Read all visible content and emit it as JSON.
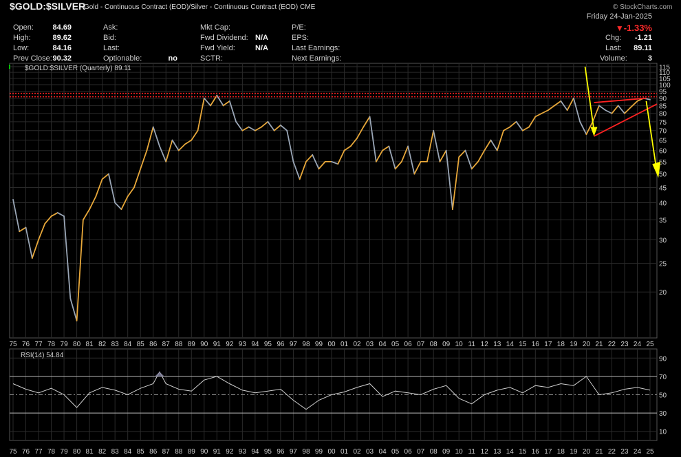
{
  "header": {
    "symbol": "$GOLD:$SILVER",
    "description": "Gold - Continuous Contract (EOD)/Silver - Continuous Contract (EOD)",
    "exchange": "CME",
    "watermark": "© StockCharts.com",
    "date": "Friday 24-Jan-2025",
    "change_pct": "-1.33%"
  },
  "quote": {
    "open_label": "Open:",
    "open": "84.69",
    "high_label": "High:",
    "high": "89.62",
    "low_label": "Low:",
    "low": "84.16",
    "prev_label": "Prev Close:",
    "prev": "90.32",
    "ask_label": "Ask:",
    "bid_label": "Bid:",
    "last_label": "Last:",
    "optionable_label": "Optionable:",
    "optionable": "no",
    "mktcap_label": "Mkt Cap:",
    "fwddiv_label": "Fwd Dividend:",
    "fwddiv": "N/A",
    "fwdyield_label": "Fwd Yield:",
    "fwdyield": "N/A",
    "sctr_label": "SCTR:",
    "pe_label": "P/E:",
    "eps_label": "EPS:",
    "lastearn_label": "Last Earnings:",
    "nextearn_label": "Next Earnings:",
    "chg_label": "Chg:",
    "chg": "-1.21",
    "last2_label": "Last:",
    "last2": "89.11",
    "volume_label": "Volume:",
    "volume": "3"
  },
  "colors": {
    "background": "#000000",
    "grid": "#2a2a2a",
    "up": "#e8a83a",
    "down": "#9aa6b6",
    "trend": "#ff2222",
    "arrow": "#ffff00",
    "rsi": "#d0d0d0"
  },
  "chart_data": [
    {
      "type": "line",
      "legend": "$GOLD:$SILVER (Quarterly) 89.11",
      "yscale": "log",
      "ylim": [
        14,
        118
      ],
      "y_ticks": [
        20,
        25,
        30,
        35,
        40,
        45,
        50,
        55,
        60,
        65,
        70,
        75,
        80,
        85,
        90,
        95,
        100,
        105,
        110,
        115
      ],
      "x_ticks": [
        "75",
        "76",
        "77",
        "78",
        "79",
        "80",
        "81",
        "82",
        "83",
        "84",
        "85",
        "86",
        "87",
        "88",
        "89",
        "90",
        "91",
        "92",
        "93",
        "94",
        "95",
        "96",
        "97",
        "98",
        "99",
        "00",
        "01",
        "02",
        "03",
        "04",
        "05",
        "06",
        "07",
        "08",
        "09",
        "10",
        "11",
        "12",
        "13",
        "14",
        "15",
        "16",
        "17",
        "18",
        "19",
        "20",
        "21",
        "22",
        "23",
        "24",
        "25"
      ],
      "x_years_start": 1975,
      "x_years_end": 2025,
      "x": [
        1975.0,
        1975.5,
        1976.0,
        1976.5,
        1977.0,
        1977.5,
        1978.0,
        1978.5,
        1979.0,
        1979.5,
        1980.0,
        1980.5,
        1981.0,
        1981.5,
        1982.0,
        1982.5,
        1983.0,
        1983.5,
        1984.0,
        1984.5,
        1985.0,
        1985.5,
        1986.0,
        1986.5,
        1987.0,
        1987.5,
        1988.0,
        1988.5,
        1989.0,
        1989.5,
        1990.0,
        1990.5,
        1991.0,
        1991.5,
        1992.0,
        1992.5,
        1993.0,
        1993.5,
        1994.0,
        1994.5,
        1995.0,
        1995.5,
        1996.0,
        1996.5,
        1997.0,
        1997.5,
        1998.0,
        1998.5,
        1999.0,
        1999.5,
        2000.0,
        2000.5,
        2001.0,
        2001.5,
        2002.0,
        2002.5,
        2003.0,
        2003.5,
        2004.0,
        2004.5,
        2005.0,
        2005.5,
        2006.0,
        2006.5,
        2007.0,
        2007.5,
        2008.0,
        2008.5,
        2009.0,
        2009.5,
        2010.0,
        2010.5,
        2011.0,
        2011.5,
        2012.0,
        2012.5,
        2013.0,
        2013.5,
        2014.0,
        2014.5,
        2015.0,
        2015.5,
        2016.0,
        2016.5,
        2017.0,
        2017.5,
        2018.0,
        2018.5,
        2019.0,
        2019.5,
        2020.0,
        2020.5,
        2021.0,
        2021.5,
        2022.0,
        2022.5,
        2023.0,
        2023.5,
        2024.0,
        2024.5,
        2025.0
      ],
      "values": [
        41,
        32,
        33,
        26,
        30,
        34,
        36,
        37,
        36,
        19,
        16,
        35,
        38,
        42,
        48,
        50,
        40,
        38,
        42,
        45,
        52,
        60,
        72,
        62,
        55,
        65,
        60,
        63,
        65,
        70,
        90,
        85,
        92,
        85,
        88,
        75,
        70,
        72,
        70,
        72,
        75,
        70,
        73,
        70,
        55,
        48,
        55,
        58,
        52,
        55,
        55,
        54,
        60,
        62,
        66,
        72,
        78,
        55,
        60,
        62,
        52,
        55,
        62,
        50,
        55,
        55,
        70,
        55,
        60,
        38,
        57,
        60,
        52,
        55,
        60,
        65,
        60,
        70,
        72,
        75,
        70,
        72,
        78,
        80,
        82,
        85,
        88,
        82,
        90,
        75,
        68,
        75,
        85,
        82,
        80,
        85,
        80,
        84,
        88,
        90,
        89
      ]
    },
    {
      "type": "line",
      "legend": "RSI(14) 54.84",
      "ylim": [
        0,
        100
      ],
      "y_ticks": [
        10,
        30,
        50,
        70,
        90
      ],
      "x": [
        1975.0,
        1976.0,
        1977.0,
        1978.0,
        1979.0,
        1980.0,
        1981.0,
        1982.0,
        1983.0,
        1984.0,
        1985.0,
        1986.0,
        1986.5,
        1987.0,
        1988.0,
        1989.0,
        1990.0,
        1991.0,
        1992.0,
        1993.0,
        1994.0,
        1995.0,
        1996.0,
        1997.0,
        1998.0,
        1999.0,
        2000.0,
        2001.0,
        2002.0,
        2003.0,
        2004.0,
        2005.0,
        2006.0,
        2007.0,
        2008.0,
        2009.0,
        2010.0,
        2011.0,
        2012.0,
        2013.0,
        2014.0,
        2015.0,
        2016.0,
        2017.0,
        2018.0,
        2019.0,
        2020.0,
        2021.0,
        2022.0,
        2023.0,
        2024.0,
        2025.0
      ],
      "values": [
        62,
        56,
        52,
        57,
        50,
        36,
        52,
        58,
        55,
        50,
        57,
        62,
        75,
        62,
        56,
        54,
        66,
        70,
        62,
        55,
        52,
        54,
        56,
        44,
        34,
        44,
        50,
        53,
        58,
        62,
        48,
        54,
        52,
        50,
        56,
        60,
        46,
        40,
        50,
        55,
        58,
        52,
        60,
        58,
        62,
        60,
        70,
        50,
        52,
        56,
        58,
        55
      ]
    }
  ]
}
